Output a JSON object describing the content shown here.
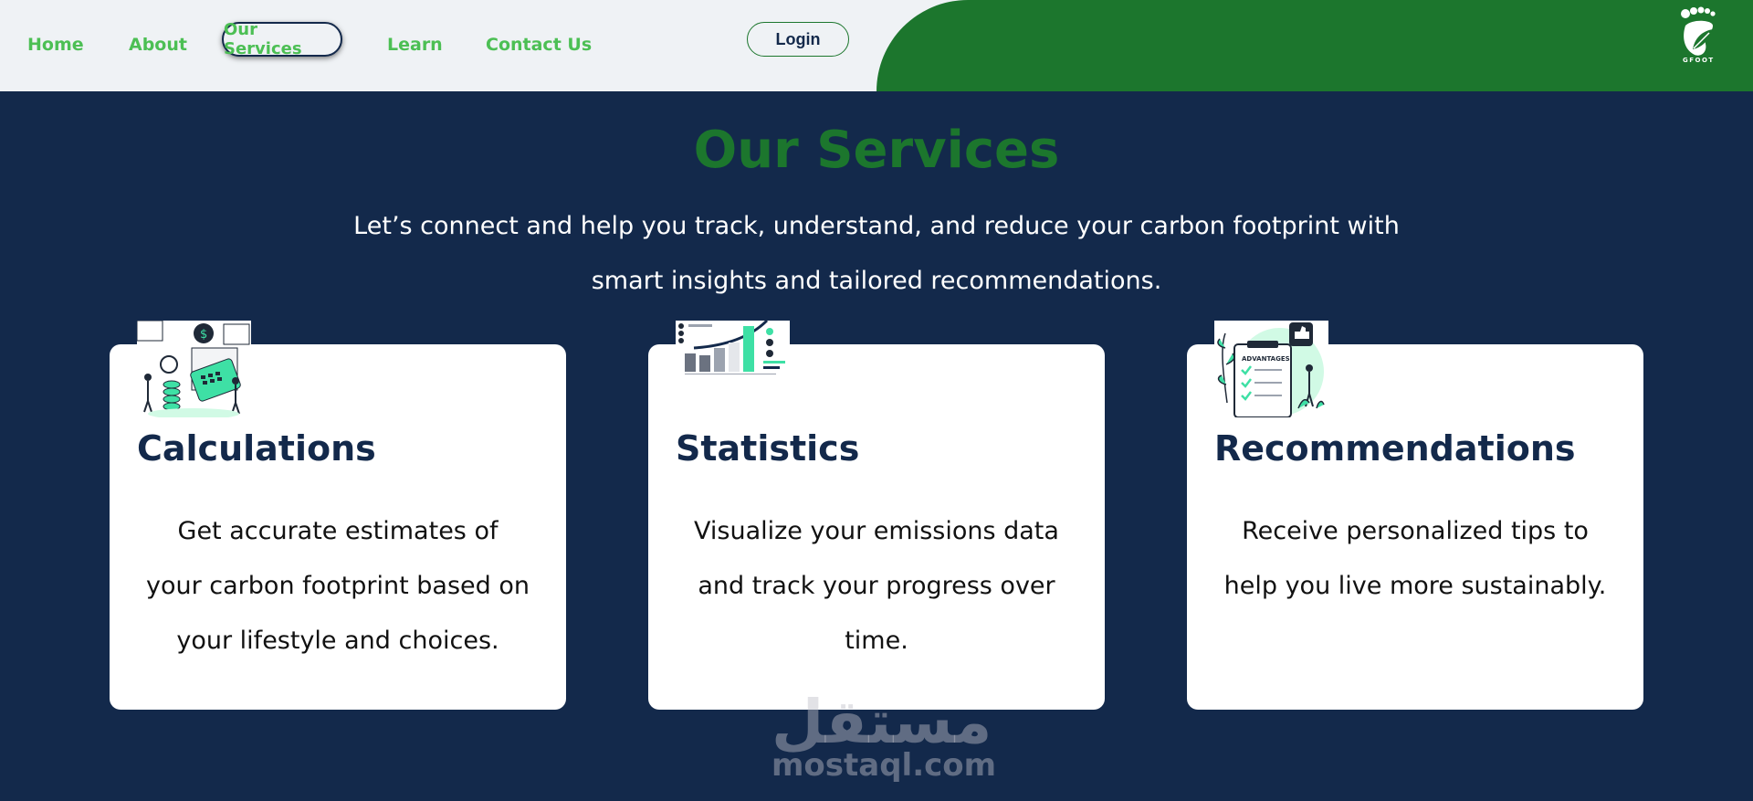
{
  "nav": {
    "items": [
      {
        "label": "Home"
      },
      {
        "label": "About"
      },
      {
        "label": "Our Services"
      },
      {
        "label": "Learn"
      },
      {
        "label": "Contact Us"
      }
    ],
    "login_label": "Login"
  },
  "brand": {
    "logo_icon": "leaf-footprint-icon",
    "logo_text": "GFOOT"
  },
  "hero": {
    "title": "Our Services",
    "subtitle": "Let’s connect and help you track, understand, and reduce your carbon footprint with smart insights and tailored recommendations."
  },
  "cards": [
    {
      "title": "Calculations",
      "description": "Get accurate estimates of your carbon footprint based on your lifestyle and choices.",
      "image_icon": "calculator-illustration"
    },
    {
      "title": "Statistics",
      "description": "Visualize your emissions data and track your progress over time.",
      "image_icon": "chart-dashboard-illustration"
    },
    {
      "title": "Recommendations",
      "description": "Receive personalized tips to help you live more sustainably.",
      "image_icon": "advantages-checklist-illustration"
    }
  ],
  "watermark": {
    "arabic": "مستقل",
    "latin": "mostaql.com"
  },
  "colors": {
    "page_bg": "#13294b",
    "header_bg": "#eff2f5",
    "brand_green": "#1c762d",
    "nav_green": "#4cbf54",
    "accent_teal": "#3ee0a5"
  }
}
